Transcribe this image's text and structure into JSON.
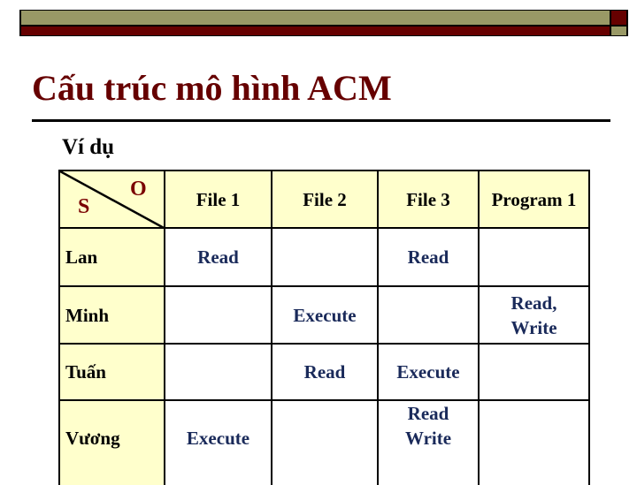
{
  "header_bar": {
    "colors": {
      "olive": "#999966",
      "dark_red": "#660000"
    }
  },
  "title": "Cấu trúc mô hình ACM",
  "subtitle": "Ví dụ",
  "matrix": {
    "corner": {
      "subject_label": "S",
      "object_label": "O"
    },
    "columns": [
      "File 1",
      "File 2",
      "File 3",
      "Program 1"
    ],
    "rows": [
      {
        "subject": "Lan",
        "cells": [
          "Read",
          "",
          "Read",
          ""
        ]
      },
      {
        "subject": "Minh",
        "cells": [
          "",
          "Execute",
          "",
          "Read,\nWrite"
        ]
      },
      {
        "subject": "Tuấn",
        "cells": [
          "",
          "Read",
          "Execute",
          ""
        ]
      },
      {
        "subject": "Vương",
        "cells": [
          "Execute",
          "",
          "Read\nWrite",
          ""
        ]
      }
    ]
  },
  "colors": {
    "title": "#660000",
    "header_fill": "#ffffcc",
    "permission_text": "#1a2a5a",
    "corner_text": "#7a0000"
  }
}
